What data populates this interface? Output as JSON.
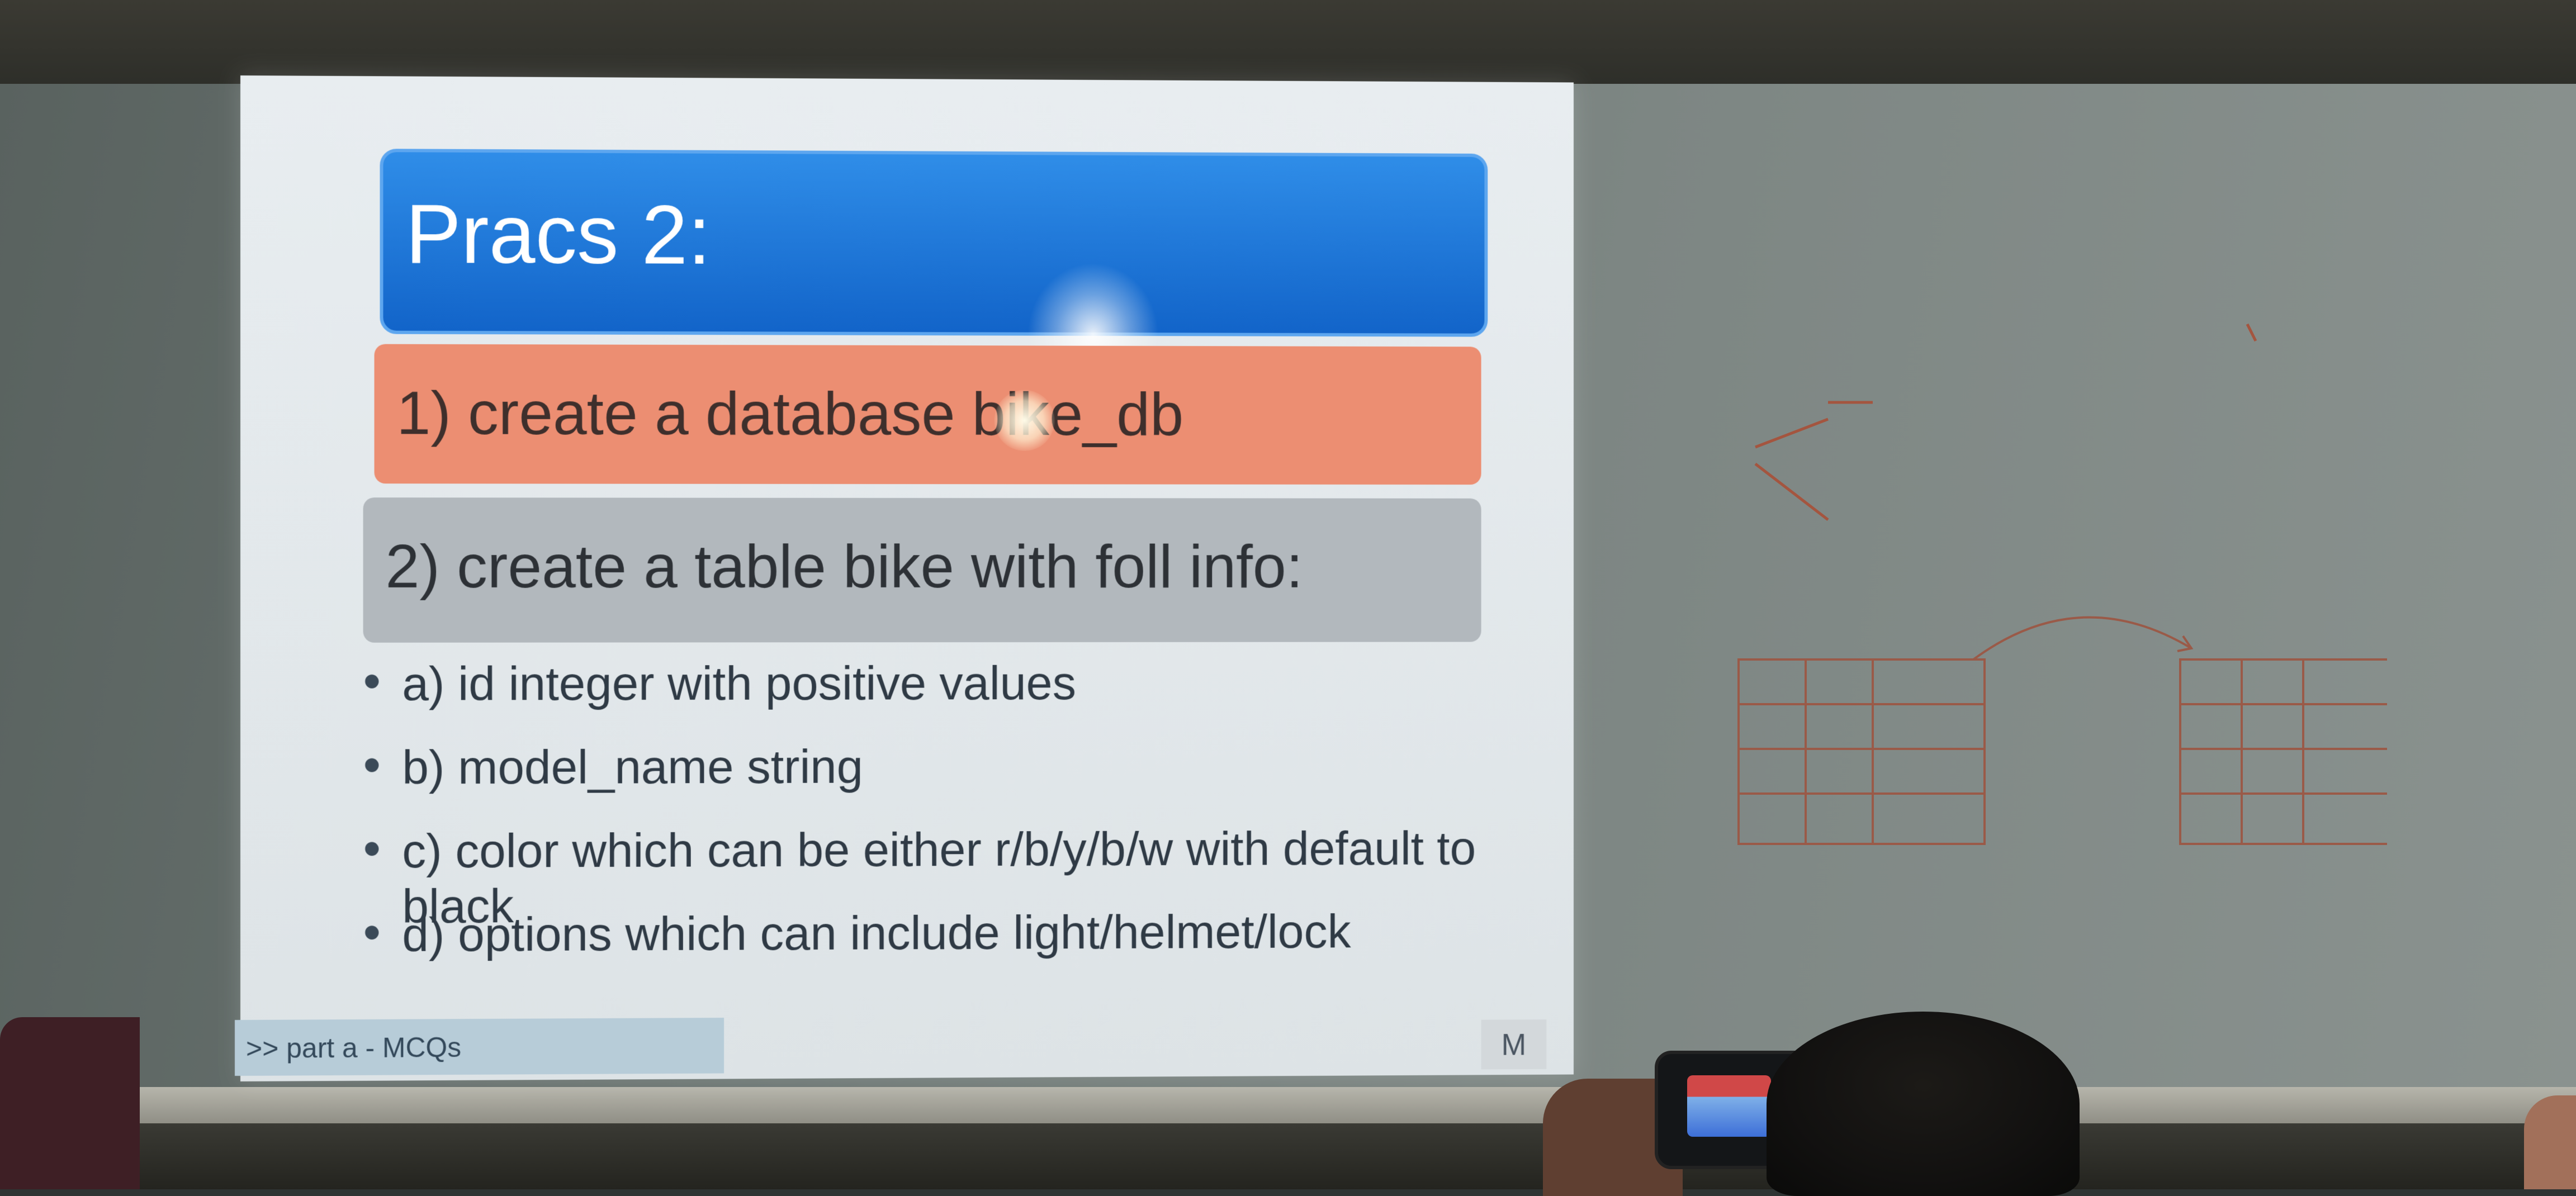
{
  "slide": {
    "title": "Pracs 2:",
    "step1": "1) create a database bike_db",
    "step2": "2) create a table bike with foll info:",
    "bullets": [
      "a) id integer with positive values",
      "b) model_name string",
      "c) color which can be either r/b/y/b/w with default to black",
      "d) options which can include light/helmet/lock"
    ],
    "footer_link": ">> part a - MCQs",
    "footer_letter": "M"
  },
  "colors": {
    "title_bar": "#1a72d8",
    "step1_bar": "#ec8e72",
    "step2_bar": "#b2b8bd",
    "whiteboard": "#707a77"
  }
}
